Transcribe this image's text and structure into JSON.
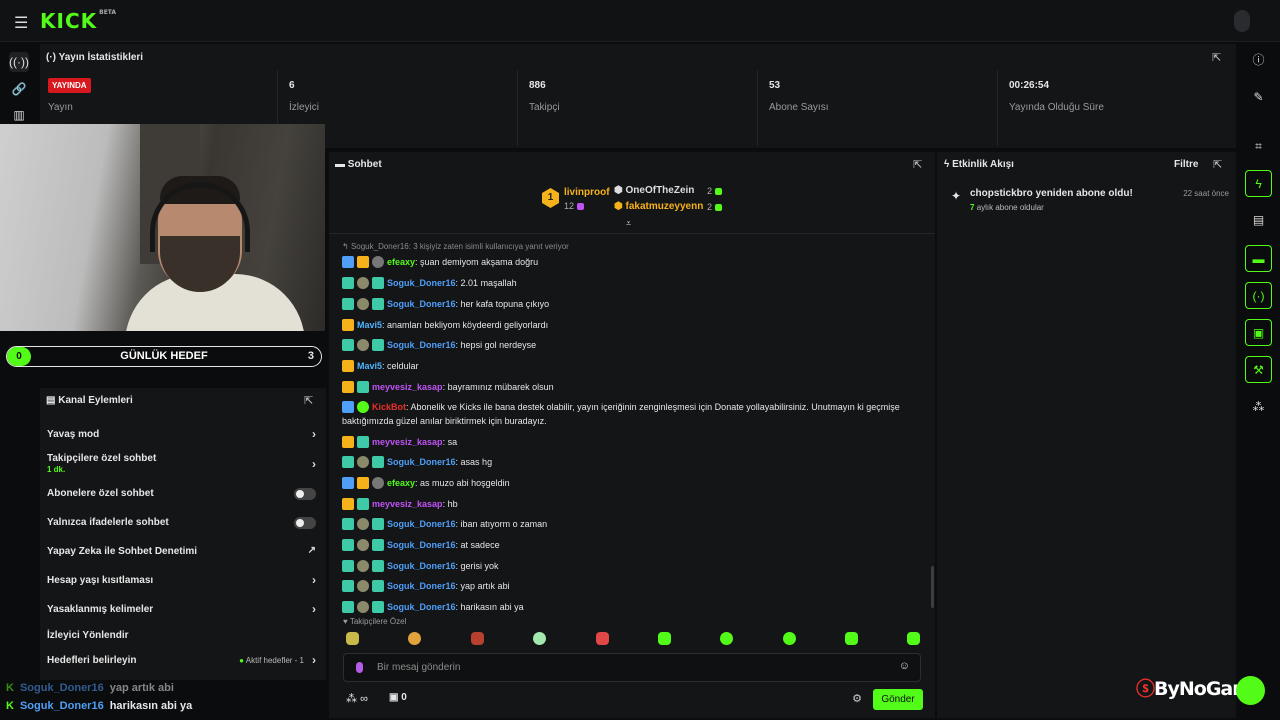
{
  "brand": {
    "logo": "KICK",
    "beta": "BETA"
  },
  "stats": {
    "title": "Yayın İstatistikleri",
    "live_badge": "YAYINDA",
    "items": [
      {
        "value": "",
        "label": "Yayın"
      },
      {
        "value": "6",
        "label": "İzleyici"
      },
      {
        "value": "886",
        "label": "Takipçi"
      },
      {
        "value": "53",
        "label": "Abone Sayısı"
      },
      {
        "value": "00:26:54",
        "label": "Yayında Olduğu Süre"
      }
    ]
  },
  "goal": {
    "current": "0",
    "title": "GÜNLÜK HEDEF",
    "target": "3"
  },
  "channel_actions": {
    "title": "Kanal Eylemleri",
    "items": [
      {
        "label": "Yavaş mod",
        "control": "chevron"
      },
      {
        "label": "Takipçilere özel sohbet",
        "sub": "1 dk.",
        "control": "chevron"
      },
      {
        "label": "Abonelere özel sohbet",
        "control": "toggle"
      },
      {
        "label": "Yalnızca ifadelerle sohbet",
        "control": "toggle"
      },
      {
        "label": "Yapay Zeka ile Sohbet Denetimi",
        "control": "external"
      },
      {
        "label": "Hesap yaşı kısıtlaması",
        "control": "chevron"
      },
      {
        "label": "Yasaklanmış kelimeler",
        "control": "chevron"
      },
      {
        "label": "İzleyici Yönlendir",
        "control": "none"
      },
      {
        "label": "Hedefleri belirleyin",
        "control": "chevron",
        "hint": "Aktif hedefler - 1"
      }
    ]
  },
  "overlay_chat": [
    {
      "user": "Soguk_Doner16",
      "text": "yap artık abi"
    },
    {
      "user": "Soguk_Doner16",
      "text": "harikasın abi ya"
    }
  ],
  "chat": {
    "title": "Sohbet",
    "pinned": [
      {
        "rank": "1",
        "user": "livinproof",
        "count": "12"
      },
      {
        "user": "OneOfTheZein",
        "count": "2"
      },
      {
        "user": "fakatmuzeyyenn",
        "count": "2"
      }
    ],
    "reply_note": "Soguk_Doner16: 3 kişiyiz zaten isimli kullanıcıya yanıt veriyor",
    "messages": [
      {
        "user": "efeaxy",
        "text": "şuan demiyom akşama doğru",
        "color": "#53fc18"
      },
      {
        "user": "Soguk_Doner16",
        "text": "2.01 maşallah",
        "color": "#4f9ff8"
      },
      {
        "user": "Soguk_Doner16",
        "text": "her kafa topuna çıkıyo",
        "color": "#4f9ff8"
      },
      {
        "user": "Mavi5",
        "text": "anamları bekliyom köydeerdi geliyorlardı",
        "color": "#4fb3ff"
      },
      {
        "user": "Soguk_Doner16",
        "text": "hepsi gol nerdeyse",
        "color": "#4f9ff8"
      },
      {
        "user": "Mavi5",
        "text": "celdular",
        "color": "#4fb3ff"
      },
      {
        "user": "meyvesiz_kasap",
        "text": "bayramınız mübarek olsun",
        "color": "#c053f5"
      },
      {
        "user": "KickBot",
        "text": "Abonelik ve Kicks ile bana destek olabilir, yayın içeriğinin zenginleşmesi için Donate yollayabilirsiniz. Unutmayın ki geçmişe baktığımızda güzel anılar biriktirmek için buradayız.",
        "color": "#e8302b"
      },
      {
        "user": "meyvesiz_kasap",
        "text": "sa",
        "color": "#c053f5"
      },
      {
        "user": "Soguk_Doner16",
        "text": "asas hg",
        "color": "#4f9ff8"
      },
      {
        "user": "efeaxy",
        "text": "as muzo abi hoşgeldin",
        "color": "#53fc18"
      },
      {
        "user": "meyvesiz_kasap",
        "text": "hb",
        "color": "#c053f5"
      },
      {
        "user": "Soguk_Doner16",
        "text": "iban atıyorm o zaman",
        "color": "#4f9ff8"
      },
      {
        "user": "Soguk_Doner16",
        "text": "at sadece",
        "color": "#4f9ff8"
      },
      {
        "user": "Soguk_Doner16",
        "text": "gerisi yok",
        "color": "#4f9ff8"
      },
      {
        "user": "Soguk_Doner16",
        "text": "yap artık abi",
        "color": "#4f9ff8"
      },
      {
        "user": "Soguk_Doner16",
        "text": "harikasın abi ya",
        "color": "#4f9ff8"
      }
    ],
    "followers_only": "Takipçilere Özel",
    "input_placeholder": "Bir mesaj gönderin",
    "infinity": "∞",
    "gift_count": "0",
    "send_label": "Gönder"
  },
  "feed": {
    "title": "Etkinlik Akışı",
    "filter_label": "Filtre",
    "items": [
      {
        "title": "chopstickbro yeniden abone oldu!",
        "months": "7",
        "sub": "aylık abone oldular",
        "time": "22 saat önce"
      }
    ]
  },
  "watermark": {
    "text": "ByNoGame"
  },
  "colors": {
    "accent": "#53fc18",
    "live": "#d7191f",
    "bg": "#0b0c0d",
    "panel": "#141517"
  }
}
